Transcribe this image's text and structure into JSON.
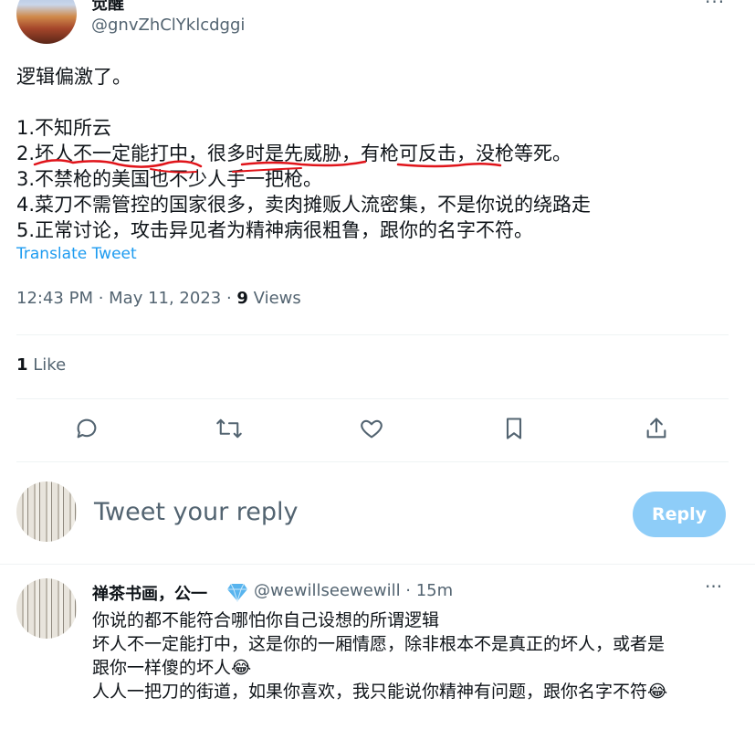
{
  "tweet": {
    "display_name": "觉醒",
    "handle": "@gnvZhClYklcdggi",
    "lines": [
      "逻辑偏激了。",
      "",
      "1.不知所云",
      "2.坏人不一定能打中，很多时是先威胁，有枪可反击，没枪等死。",
      "3.不禁枪的美国也不少人手一把枪。",
      "4.菜刀不需管控的国家很多，卖肉摊贩人流密集，不是你说的绕路走",
      "5.正常讨论，攻击异见者为精神病很粗鲁，跟你的名字不符。"
    ],
    "translate_label": "Translate Tweet",
    "timestamp": "12:43 PM · May 11, 2023 · ",
    "views_count": "9",
    "views_label": " Views",
    "likes_count": "1",
    "likes_label": " Like",
    "more_label": "···"
  },
  "composer": {
    "placeholder": "Tweet your reply",
    "button_label": "Reply"
  },
  "reply": {
    "display_name": "禅茶书画，公一",
    "handle_time": "@wewillseewewill · 15m",
    "more_label": "···",
    "lines": [
      "你说的都不能符合哪怕你自己设想的所谓逻辑",
      "坏人不一定能打中，这是你的一厢情愿，除非根本不是真正的坏人，或者是",
      "跟你一样傻的坏人😂",
      "人人一把刀的街道，如果你喜欢，我只能说你精神有问题，跟你名字不符😂"
    ]
  },
  "icons": [
    "comment-icon",
    "retweet-icon",
    "like-icon",
    "bookmark-icon",
    "share-icon",
    "verified-diamond-icon"
  ],
  "colors": {
    "accent": "#1d9bf0",
    "annotation": "#e0141a",
    "reply_button": "#8ecdf8"
  }
}
